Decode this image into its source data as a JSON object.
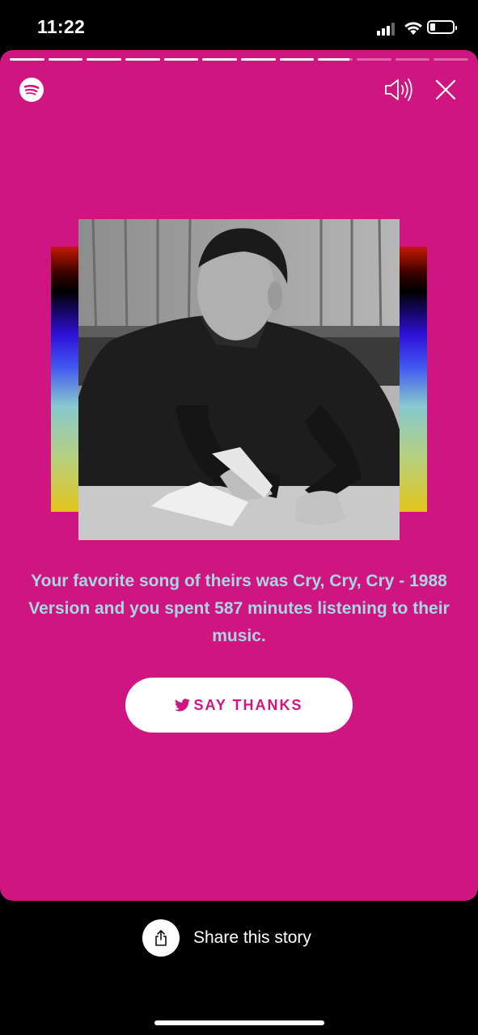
{
  "status_bar": {
    "time": "11:22",
    "signal_icon": "cellular-signal-icon",
    "wifi_icon": "wifi-icon",
    "battery_icon": "battery-icon",
    "battery_level": 0.2
  },
  "story": {
    "background_color": "#ce1580",
    "progress": {
      "segment_count": 12,
      "segments_complete": 8,
      "current_segment_fraction": 0.9
    },
    "header": {
      "logo_icon": "spotify-logo-icon",
      "volume_icon": "volume-icon",
      "close_icon": "close-icon"
    },
    "artist_photo_icon": "artist-photo",
    "message": "Your favorite song of theirs was Cry, Cry, Cry - 1988 Version and you spent 587 minutes listening to their music.",
    "message_color": "#a9d6e5",
    "cta": {
      "icon": "twitter-icon",
      "label": "SAY THANKS"
    }
  },
  "share": {
    "icon": "share-icon",
    "label": "Share this story"
  }
}
